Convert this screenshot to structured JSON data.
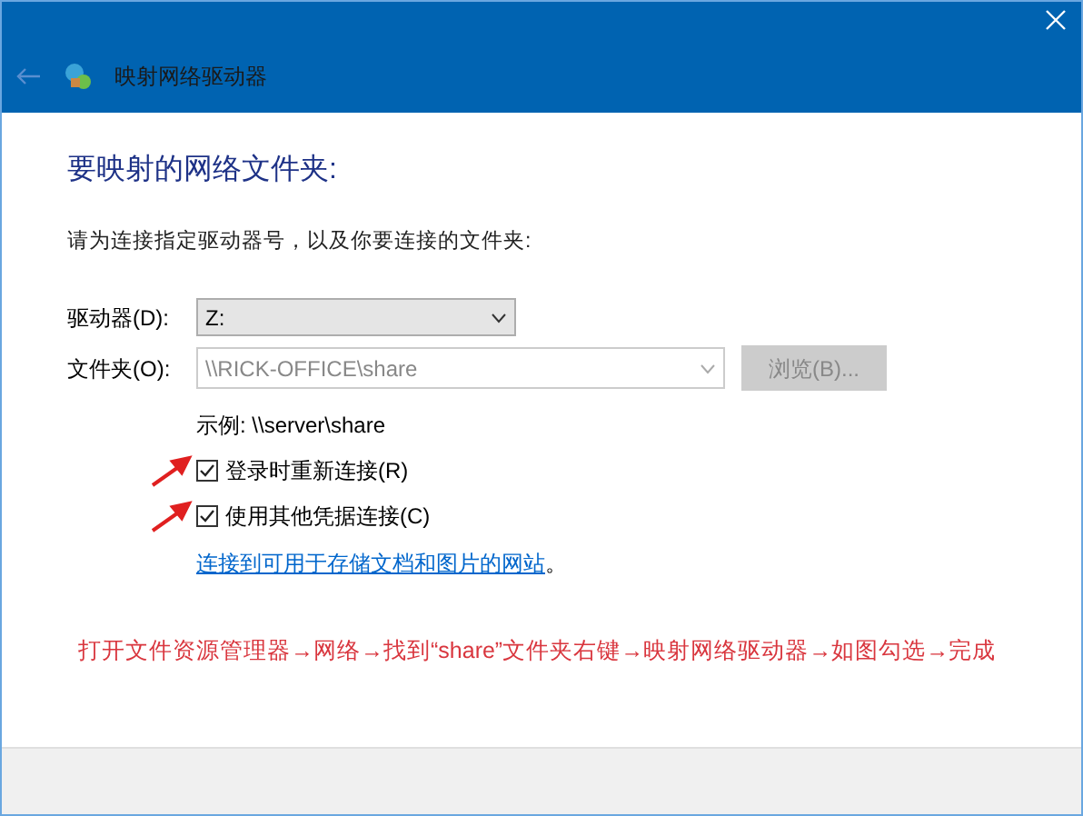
{
  "window": {
    "title": "映射网络驱动器"
  },
  "heading": "要映射的网络文件夹:",
  "instruction": "请为连接指定驱动器号，以及你要连接的文件夹:",
  "drive": {
    "label": "驱动器(D):",
    "value": "Z:"
  },
  "folder": {
    "label": "文件夹(O):",
    "value": "\\\\RICK-OFFICE\\share",
    "disabled": true
  },
  "browse_button": {
    "label": "浏览(B)...",
    "disabled": true
  },
  "example": "示例: \\\\server\\share",
  "checkboxes": [
    {
      "label": "登录时重新连接(R)",
      "checked": true
    },
    {
      "label": "使用其他凭据连接(C)",
      "checked": true
    }
  ],
  "link": {
    "text": "连接到可用于存储文档和图片的网站",
    "suffix": "。"
  },
  "annotation": "打开文件资源管理器→网络→找到“share”文件夹右键→映射网络驱动器→如图勾选→完成"
}
